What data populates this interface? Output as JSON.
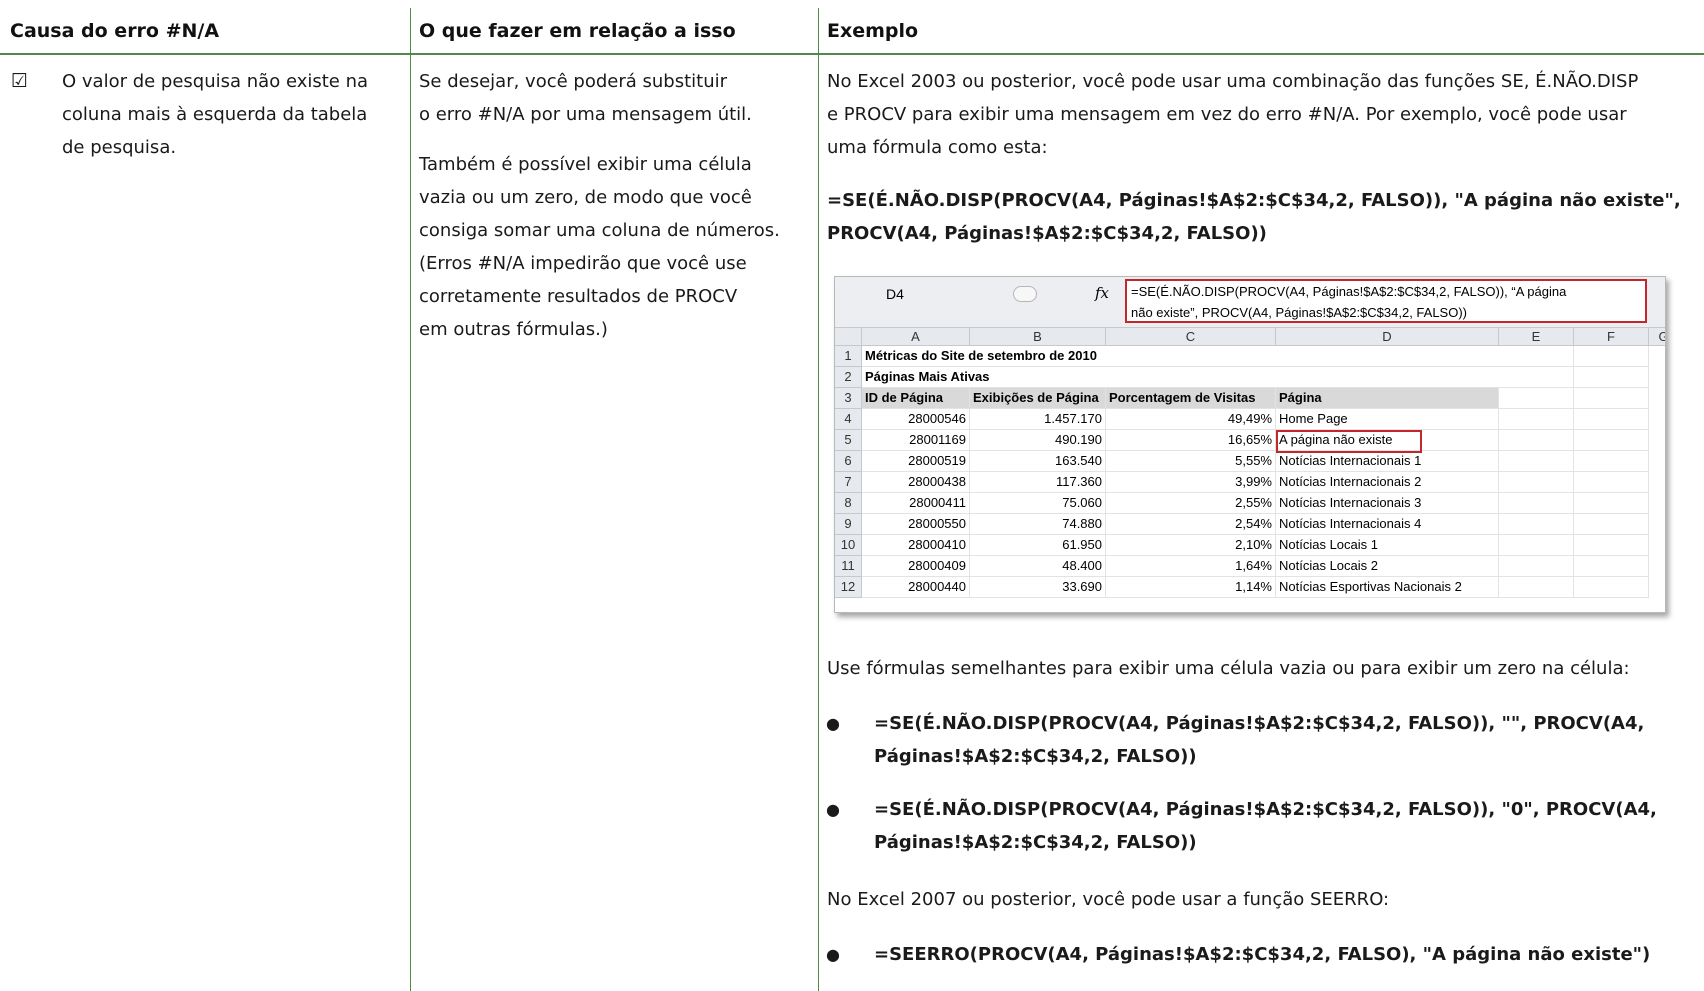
{
  "table": {
    "headers": [
      "Causa do erro #N/A",
      "O que fazer em relação a isso",
      "Exemplo"
    ],
    "col1": {
      "check_icon": "☑",
      "lines": [
        "O valor de pesquisa não existe na",
        "coluna mais à esquerda da tabela",
        "de pesquisa."
      ]
    },
    "col2": {
      "para1": [
        "Se desejar, você poderá substituir",
        "o erro #N/A por uma mensagem útil."
      ],
      "para2": [
        "Também é possível exibir uma célula",
        "vazia ou um zero, de modo que você",
        "consiga somar uma coluna de números.",
        "(Erros #N/A impedirão que você use",
        "corretamente resultados de PROCV",
        "em outras fórmulas.)"
      ]
    },
    "col3": {
      "intro": [
        "No Excel 2003 ou posterior, você pode usar uma combinação das funções SE, É.NÃO.DISP",
        "e PROCV para exibir uma mensagem em vez do erro #N/A. Por exemplo, você pode usar",
        "uma fórmula como esta:"
      ],
      "formula1": [
        "=SE(É.NÃO.DISP(PROCV(A4, Páginas!$A$2:$C$34,2, FALSO)), \"A página não existe\",",
        "PROCV(A4, Páginas!$A$2:$C$34,2, FALSO))"
      ],
      "similar_text": "Use fórmulas semelhantes para exibir uma célula vazia ou para exibir um zero na célula:",
      "bullets": [
        [
          "=SE(É.NÃO.DISP(PROCV(A4, Páginas!$A$2:$C$34,2, FALSO)), \"\", PROCV(A4,",
          "Páginas!$A$2:$C$34,2, FALSO))"
        ],
        [
          "=SE(É.NÃO.DISP(PROCV(A4, Páginas!$A$2:$C$34,2, FALSO)), \"0\", PROCV(A4,",
          "Páginas!$A$2:$C$34,2, FALSO))"
        ]
      ],
      "excel2007_text": "No Excel 2007 ou posterior, você pode usar a função SEERRO:",
      "bullet3": "=SEERRO(PROCV(A4, Páginas!$A$2:$C$34,2, FALSO), \"A página não existe\")",
      "bullet_symbol": "●"
    }
  },
  "excel": {
    "name_box": "D4",
    "fx": "fx",
    "formula_lines": [
      "=SE(É.NÃO.DISP(PROCV(A4, Páginas!$A$2:$C$34,2, FALSO)), “A página",
      "não existe”, PROCV(A4, Páginas!$A$2:$C$34,2, FALSO))"
    ],
    "columns": [
      "A",
      "B",
      "C",
      "D",
      "E",
      "F",
      "G"
    ],
    "rows": [
      {
        "n": "1",
        "cells": [
          "Métricas do Site de setembro de 2010",
          "",
          "",
          ""
        ]
      },
      {
        "n": "2",
        "cells": [
          "Páginas Mais Ativas",
          "",
          "",
          ""
        ]
      },
      {
        "n": "3",
        "cells": [
          "ID de Página",
          "Exibições de Página",
          "Porcentagem de Visitas",
          "Página"
        ]
      },
      {
        "n": "4",
        "cells": [
          "28000546",
          "1.457.170",
          "49,49%",
          "Home Page"
        ]
      },
      {
        "n": "5",
        "cells": [
          "28001169",
          "490.190",
          "16,65%",
          "A página não existe"
        ]
      },
      {
        "n": "6",
        "cells": [
          "28000519",
          "163.540",
          "5,55%",
          "Notícias Internacionais 1"
        ]
      },
      {
        "n": "7",
        "cells": [
          "28000438",
          "117.360",
          "3,99%",
          "Notícias Internacionais 2"
        ]
      },
      {
        "n": "8",
        "cells": [
          "28000411",
          "75.060",
          "2,55%",
          "Notícias Internacionais 3"
        ]
      },
      {
        "n": "9",
        "cells": [
          "28000550",
          "74.880",
          "2,54%",
          "Notícias Internacionais 4"
        ]
      },
      {
        "n": "10",
        "cells": [
          "28000410",
          "61.950",
          "2,10%",
          "Notícias Locais 1"
        ]
      },
      {
        "n": "11",
        "cells": [
          "28000409",
          "48.400",
          "1,64%",
          "Notícias Locais 2"
        ]
      },
      {
        "n": "12",
        "cells": [
          "28000440",
          "33.690",
          "1,14%",
          "Notícias Esportivas Nacionais 2"
        ]
      }
    ]
  }
}
